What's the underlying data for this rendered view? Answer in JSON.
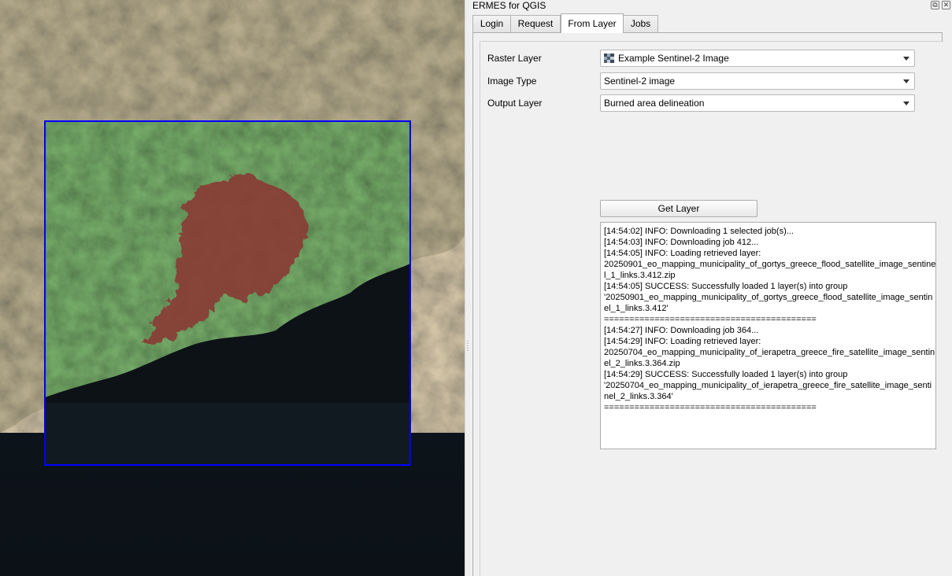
{
  "dock": {
    "title": "ERMES for QGIS",
    "float_icon": "float-window-icon",
    "close_icon": "close-icon"
  },
  "tabs": [
    {
      "label": "Login",
      "active": false
    },
    {
      "label": "Request",
      "active": false
    },
    {
      "label": "From Layer",
      "active": true
    },
    {
      "label": "Jobs",
      "active": false
    }
  ],
  "form": {
    "raster_layer_label": "Raster Layer",
    "raster_layer_value": "Example Sentinel-2 Image",
    "raster_layer_icon": "raster-layer-icon",
    "image_type_label": "Image Type",
    "image_type_value": "Sentinel-2 image",
    "output_layer_label": "Output Layer",
    "output_layer_value": "Burned area delineation",
    "get_layer_label": "Get Layer"
  },
  "log": [
    "[14:54:02] INFO: Downloading 1 selected job(s)...",
    "[14:54:03] INFO: Downloading job 412...",
    "[14:54:05] INFO: Loading retrieved layer:",
    "20250901_eo_mapping_municipality_of_gortys_greece_flood_satellite_image_sentine",
    "l_1_links.3.412.zip",
    "[14:54:05] SUCCESS: Successfully loaded 1 layer(s) into group",
    "'20250901_eo_mapping_municipality_of_gortys_greece_flood_satellite_image_sentin",
    "el_1_links.3.412'",
    "==========================================",
    "[14:54:27] INFO: Downloading job 364...",
    "[14:54:29] INFO: Loading retrieved layer:",
    "20250704_eo_mapping_municipality_of_ierapetra_greece_fire_satellite_image_sentin",
    "el_2_links.3.364.zip",
    "[14:54:29] SUCCESS: Successfully loaded 1 layer(s) into group",
    "'20250704_eo_mapping_municipality_of_ierapetra_greece_fire_satellite_image_senti",
    "nel_2_links.3.364'",
    "=========================================="
  ],
  "colors": {
    "extent_outline": "#0000ff",
    "burned_area": "#8a3a36",
    "vegetation": "#3f6e2e",
    "sea": "#0c141b"
  }
}
